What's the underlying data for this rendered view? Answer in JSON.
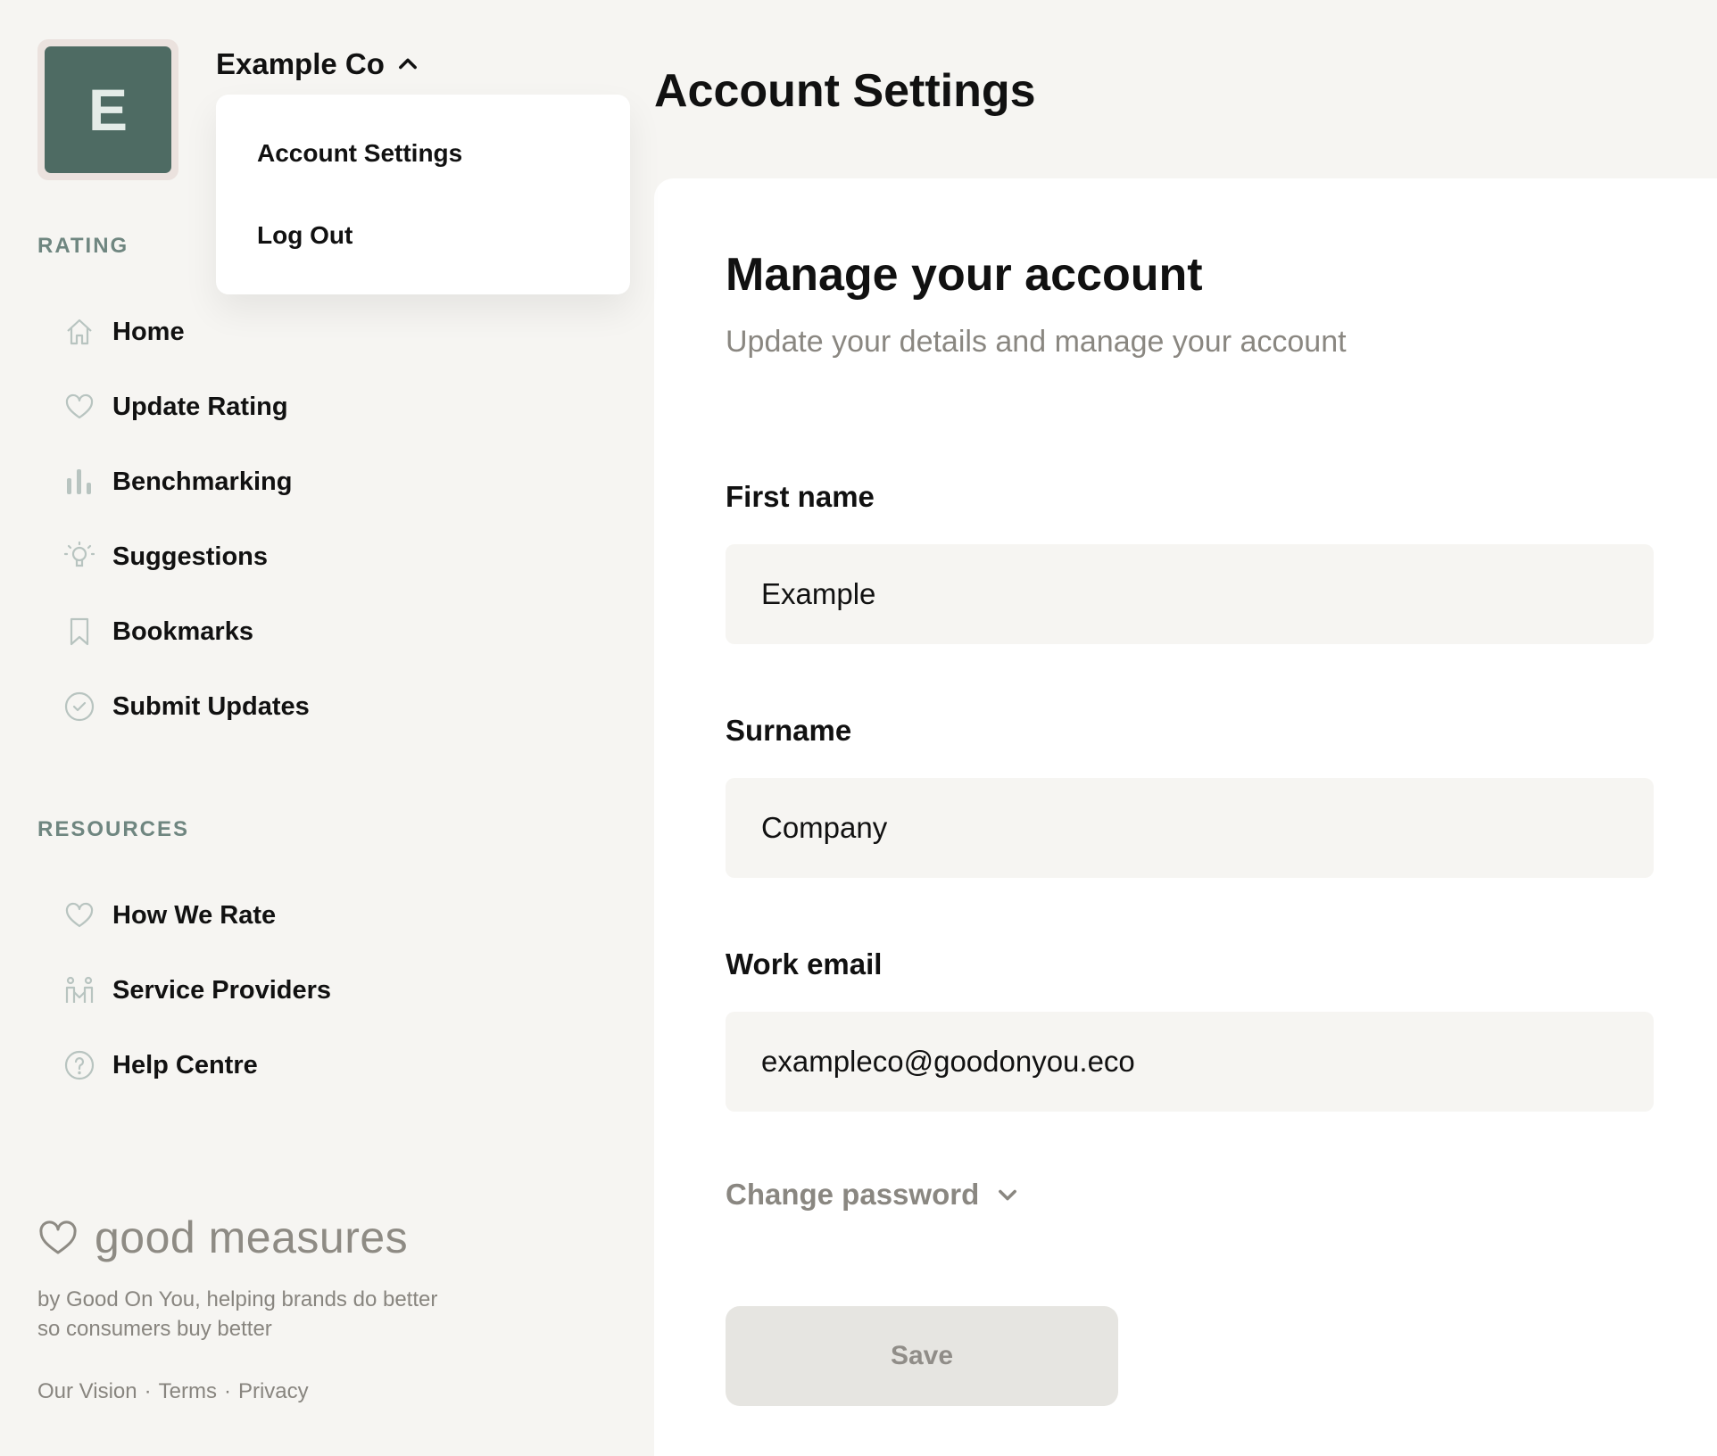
{
  "org": {
    "avatar_letter": "E",
    "name": "Example Co"
  },
  "account_menu": {
    "items": [
      {
        "label": "Account Settings"
      },
      {
        "label": "Log Out"
      }
    ]
  },
  "sidebar": {
    "rating_section": {
      "label": "RATING",
      "items": [
        {
          "label": "Home",
          "icon": "home-icon"
        },
        {
          "label": "Update Rating",
          "icon": "heart-icon"
        },
        {
          "label": "Benchmarking",
          "icon": "bar-chart-icon"
        },
        {
          "label": "Suggestions",
          "icon": "lightbulb-icon"
        },
        {
          "label": "Bookmarks",
          "icon": "bookmark-icon"
        },
        {
          "label": "Submit Updates",
          "icon": "check-circle-icon"
        }
      ]
    },
    "resources_section": {
      "label": "RESOURCES",
      "items": [
        {
          "label": "How We Rate",
          "icon": "heart-icon"
        },
        {
          "label": "Service Providers",
          "icon": "people-icon"
        },
        {
          "label": "Help Centre",
          "icon": "help-circle-icon"
        }
      ]
    },
    "brand": {
      "name": "good measures",
      "tagline": "by Good On You, helping brands do better so consumers buy better"
    },
    "footer_links": [
      "Our Vision",
      "Terms",
      "Privacy"
    ],
    "footer_separator": "·"
  },
  "main": {
    "page_title": "Account Settings",
    "card": {
      "title": "Manage your account",
      "subtitle": "Update your details and manage your account",
      "fields": [
        {
          "label": "First name",
          "value": "Example"
        },
        {
          "label": "Surname",
          "value": "Company"
        },
        {
          "label": "Work email",
          "value": "exampleco@goodonyou.eco"
        }
      ],
      "change_password_label": "Change password",
      "save_label": "Save"
    }
  },
  "colors": {
    "background": "#f6f5f2",
    "avatar": "#4e6b63",
    "section_label": "#6f8680",
    "muted_text": "#8a8781",
    "icon": "#b8c4c0"
  }
}
